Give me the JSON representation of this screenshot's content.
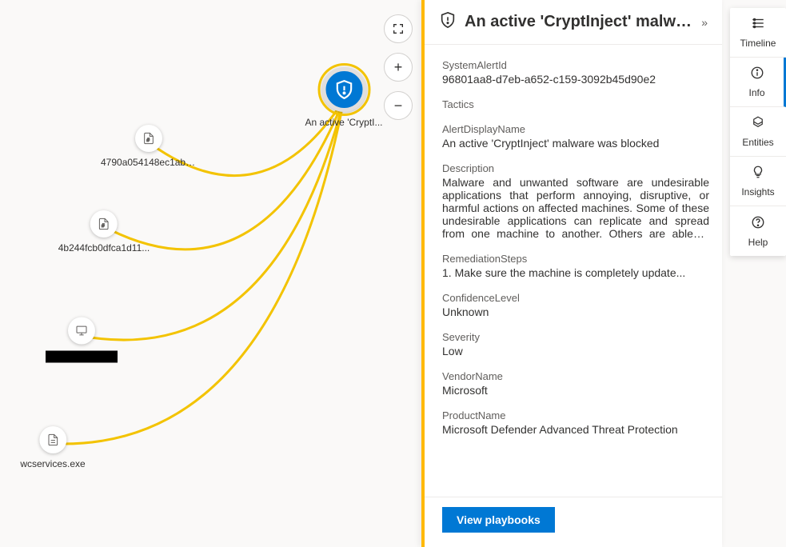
{
  "colors": {
    "accent": "#0078d4",
    "warning": "#ffb900"
  },
  "graph": {
    "primary": {
      "label": "An active 'CryptI...",
      "icon": "shield-alert-icon"
    },
    "node1": {
      "label": "4790a054148ec1abe...",
      "icon": "hash-file-icon"
    },
    "node2": {
      "label": "4b244fcb0dfca1d11...",
      "icon": "hash-file-icon"
    },
    "node3": {
      "label": "",
      "icon": "host-icon",
      "redacted": true
    },
    "node4": {
      "label": "wcservices.exe",
      "icon": "file-icon"
    }
  },
  "controls": {
    "fit": "⛶",
    "zoom_in": "+",
    "zoom_out": "−"
  },
  "details": {
    "expand": "»",
    "title_icon": "shield-alert-icon",
    "title": "An active 'CryptInject' malware ...",
    "fields": {
      "SystemAlertId": {
        "k": "SystemAlertId",
        "v": "96801aa8-d7eb-a652-c159-3092b45d90e2"
      },
      "Tactics": {
        "k": "Tactics",
        "v": ""
      },
      "AlertDisplayName": {
        "k": "AlertDisplayName",
        "v": "An active 'CryptInject' malware was blocked"
      },
      "Description": {
        "k": "Description",
        "v": "Malware and unwanted software are undesirable applications that perform annoying, disruptive, or harmful actions on affected machines. Some of these undesirable applications can replicate and spread from one machine to another. Others are able to receive commands from remote attackers and perform activities associated with cyber attacks."
      },
      "RemediationSteps": {
        "k": "RemediationSteps",
        "v": "1. Make sure the machine is completely update..."
      },
      "ConfidenceLevel": {
        "k": "ConfidenceLevel",
        "v": "Unknown"
      },
      "Severity": {
        "k": "Severity",
        "v": "Low"
      },
      "VendorName": {
        "k": "VendorName",
        "v": "Microsoft"
      },
      "ProductName": {
        "k": "ProductName",
        "v": "Microsoft Defender Advanced Threat Protection"
      }
    },
    "footer_button": "View playbooks"
  },
  "rail": {
    "timeline": "Timeline",
    "info": "Info",
    "entities": "Entities",
    "insights": "Insights",
    "help": "Help"
  }
}
